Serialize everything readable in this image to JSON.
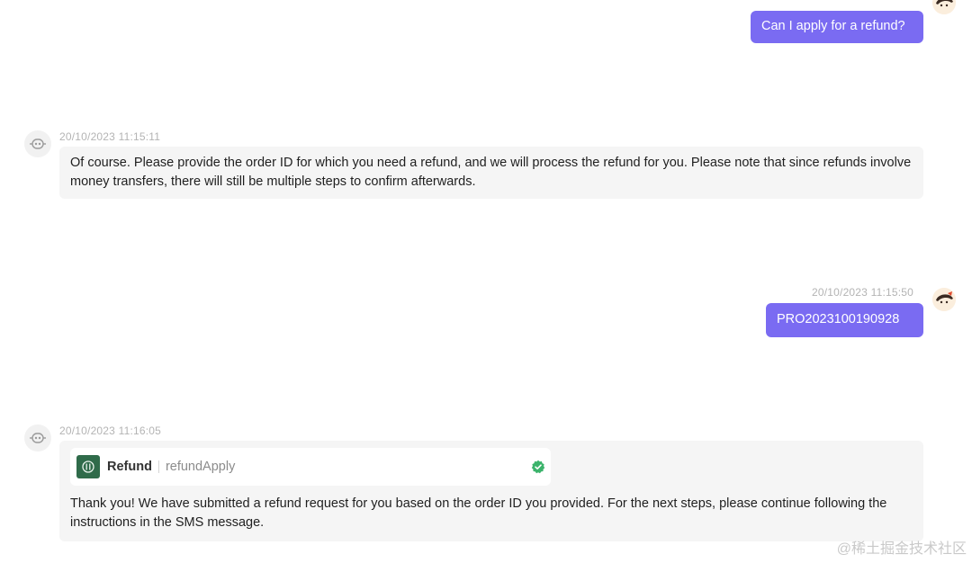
{
  "messages": {
    "user_1": {
      "text": "Can I apply for a refund?"
    },
    "bot_1": {
      "timestamp": "20/10/2023 11:15:11",
      "text": "Of course. Please provide the order ID for which you need a refund, and we will process the refund for you. Please note that since refunds involve money transfers, there will still be multiple steps to confirm afterwards."
    },
    "user_2": {
      "timestamp": "20/10/2023 11:15:50",
      "text": "PRO2023100190928"
    },
    "bot_2": {
      "timestamp": "20/10/2023 11:16:05",
      "tool": {
        "name": "Refund",
        "function": "refundApply",
        "status": "success"
      },
      "text": "Thank you! We have submitted a refund request for you based on the order ID you provided. For the next steps, please continue following the instructions in the SMS message."
    }
  },
  "watermark": "@稀土掘金技术社区",
  "colors": {
    "user_bubble": "#7a6bf2",
    "bot_bubble": "#f5f5f5",
    "success_check": "#3bb36b",
    "tool_logo": "#2f6b4a"
  },
  "icons": {
    "bot_avatar": "robot-icon",
    "user_avatar": "user-avatar-icon",
    "tool_logo": "plugin-logo-icon",
    "status": "check-badge-icon"
  }
}
